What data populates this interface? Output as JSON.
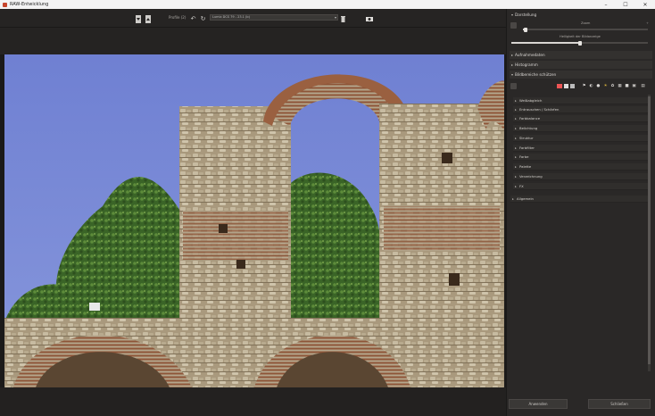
{
  "window": {
    "title": "RAW-Entwicklung"
  },
  "toolbar": {
    "profile_label": "Profile (2)",
    "profile_value": "Lumix DCS 79 - 23.1 (b)"
  },
  "panel": {
    "sections": {
      "display": "Darstellung",
      "capture_data": "Aufnahmedaten",
      "histogram": "Histogramm",
      "protect_areas": "Bildbereiche schützen"
    },
    "zoom_label": "Zoom",
    "zoom_value": 0.05,
    "speed_label": "Helligkeit der Bildanzeige",
    "speed_value": 0.5,
    "subsections": [
      "Weißabgleich",
      "Entrauschen / Schärfen",
      "Farbbalance",
      "Belichtung",
      "Struktur",
      "Farbfilter",
      "Farbe",
      "Palette",
      "Verzeichnung",
      "FX"
    ],
    "general": "Allgemein"
  },
  "footer": {
    "apply": "Anwenden",
    "close": "Schließen"
  },
  "colors": {
    "sky": "#6c7fcf",
    "stone": "#b3a68c",
    "brick": "#8a5236",
    "foliage": "#3e6b2a"
  }
}
